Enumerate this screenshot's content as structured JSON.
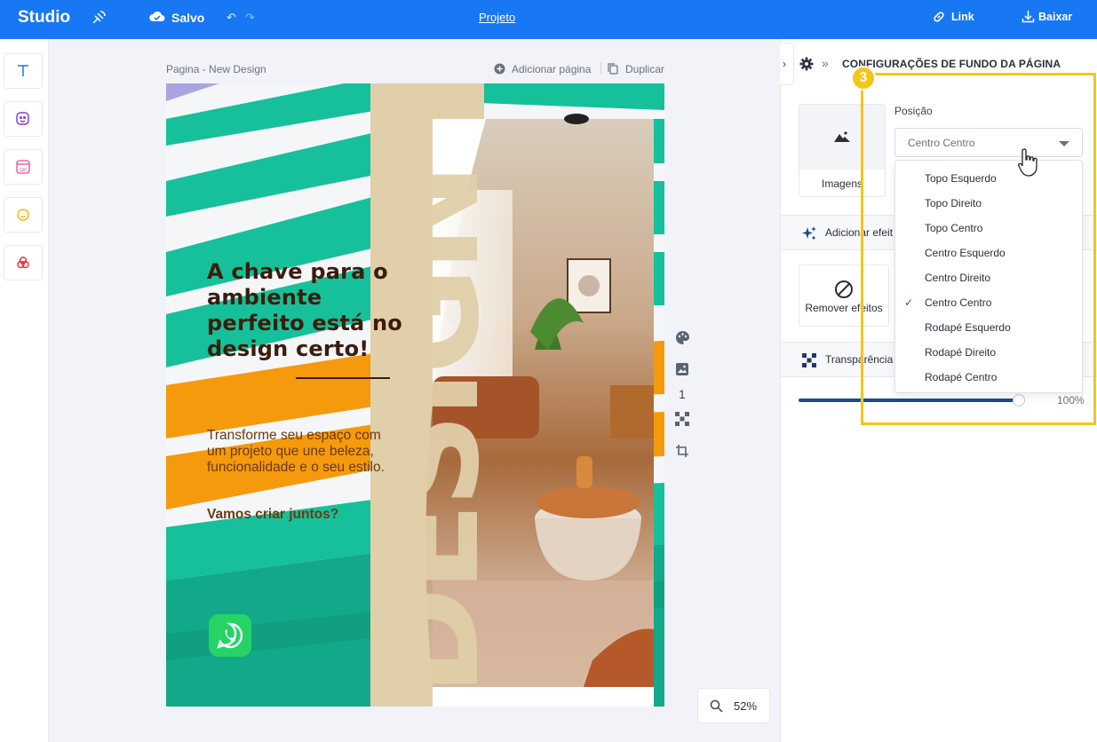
{
  "topbar": {
    "logo": "Studio",
    "saved": "Salvo",
    "undo_icon": "↶",
    "redo_icon": "↷",
    "project": "Projeto",
    "link": "Link",
    "download": "Baixar"
  },
  "canvas": {
    "page_title": "Pagina - New Design",
    "add_page": "Adicionar página",
    "duplicate": "Duplicar",
    "page_number": "1",
    "zoom": "52%"
  },
  "design": {
    "headline": "A chave para o ambiente perfeito está no design certo!",
    "body": "Transforme seu espaço com um projeto que une beleza, funcionalidade e o seu estilo.",
    "cta": "Vamos criar juntos?",
    "vertical_word": "DESIGN"
  },
  "panel": {
    "collapse_icon": "›",
    "breadcrumb_icon": "»",
    "title": "CONFIGURAÇÕES DE FUNDO DA PÁGINA",
    "images_label": "Imagens",
    "position_label": "Posição",
    "position_value": "Centro Centro",
    "effects_section": "Adicionar efeit",
    "remove_effects": "Remover efeitos",
    "transparency_section": "Transparência",
    "transparency_value": "100%",
    "transparency_level": 1.0
  },
  "dropdown": {
    "options": [
      "Topo Esquerdo",
      "Topo Direito",
      "Topo Centro",
      "Centro Esquerdo",
      "Centro Direito",
      "Centro Centro",
      "Rodapé Esquerdo",
      "Rodapé Direito",
      "Rodapé Centro"
    ],
    "selected": "Centro Centro",
    "check_icon": "✓"
  },
  "annotation": {
    "step": "3"
  },
  "colors": {
    "topbar": "#1877f2",
    "highlight": "#f5c518",
    "teal": "#16c09a",
    "orange": "#f59a0c",
    "beige": "#e0cfa9"
  }
}
